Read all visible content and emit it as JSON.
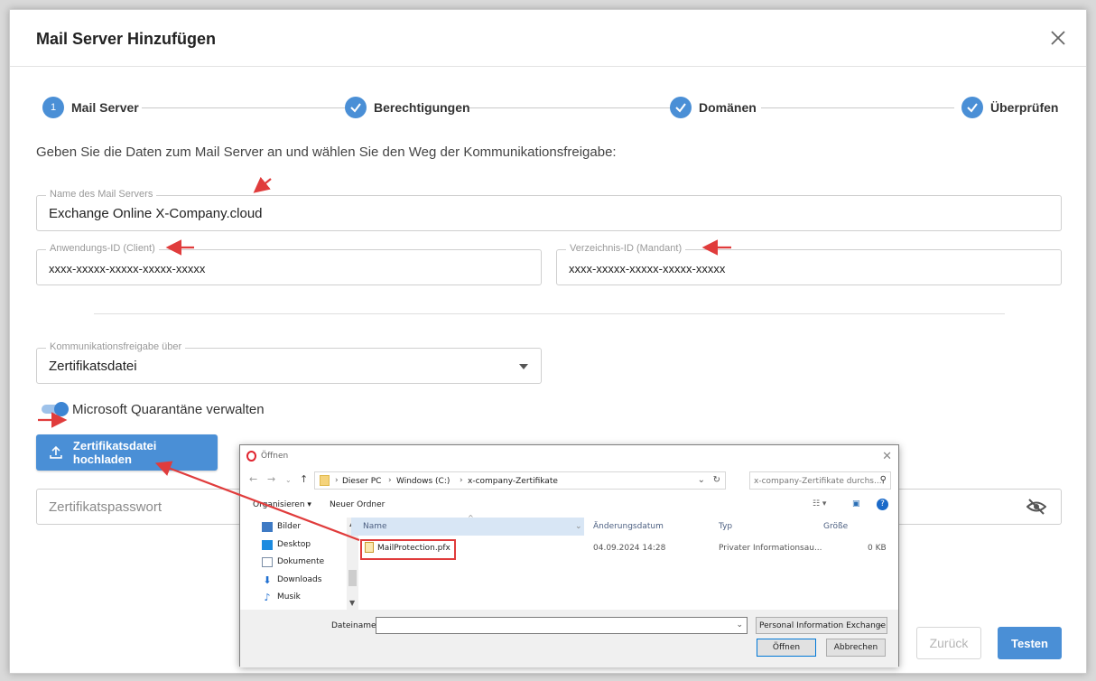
{
  "dialog": {
    "title": "Mail Server Hinzufügen",
    "intro": "Geben Sie die Daten zum Mail Server an und wählen Sie den Weg der Kommunikationsfreigabe:"
  },
  "stepper": {
    "steps": [
      {
        "label": "Mail Server",
        "number": "1",
        "state": "active"
      },
      {
        "label": "Berechtigungen",
        "state": "done"
      },
      {
        "label": "Domänen",
        "state": "done"
      },
      {
        "label": "Überprüfen",
        "state": "done"
      }
    ]
  },
  "form": {
    "server_name": {
      "label": "Name des Mail Servers",
      "value": "Exchange Online X-Company.cloud"
    },
    "app_id": {
      "label": "Anwendungs-ID (Client)",
      "value": "xxxx-xxxxx-xxxxx-xxxxx-xxxxx"
    },
    "dir_id": {
      "label": "Verzeichnis-ID (Mandant)",
      "value": "xxxx-xxxxx-xxxxx-xxxxx-xxxxx"
    },
    "comm": {
      "label": "Kommunikationsfreigabe über",
      "value": "Zertifikatsdatei"
    },
    "quarantine_toggle": {
      "label": "Microsoft Quarantäne verwalten",
      "on": true
    },
    "upload_button": "Zertifikatsdatei hochladen",
    "password": {
      "placeholder": "Zertifikatspasswort"
    }
  },
  "footer": {
    "back": "Zurück",
    "test": "Testen"
  },
  "file_dialog": {
    "title": "Öffnen",
    "path": [
      "Dieser PC",
      "Windows (C:)",
      "x-company-Zertifikate"
    ],
    "search_placeholder": "x-company-Zertifikate durchs...",
    "organize": "Organisieren ▾",
    "new_folder": "Neuer Ordner",
    "nav_items": [
      "Bilder",
      "Desktop",
      "Dokumente",
      "Downloads",
      "Musik"
    ],
    "columns": {
      "name": "Name",
      "date": "Änderungsdatum",
      "type": "Typ",
      "size": "Größe"
    },
    "files": [
      {
        "name": "MailProtection.pfx",
        "date": "04.09.2024 14:28",
        "type": "Privater Informationsau...",
        "size": "0 KB"
      }
    ],
    "filename_label": "Dateiname:",
    "filename_value": "",
    "file_type": "Personal Information Exchange",
    "open": "Öffnen",
    "cancel": "Abbrechen"
  },
  "colors": {
    "accent": "#4a8fd6",
    "annotation": "#e03c3c"
  }
}
